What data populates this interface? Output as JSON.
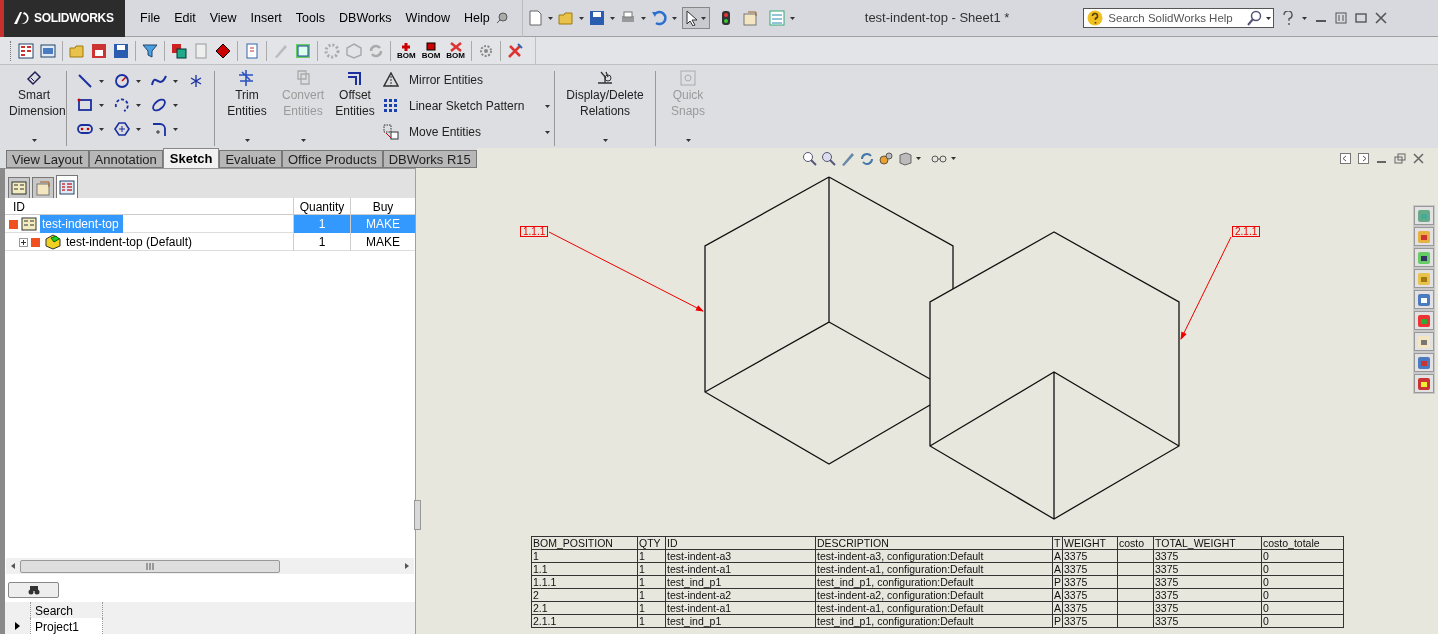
{
  "app": {
    "logo": "SOLIDWORKS"
  },
  "menu": [
    "File",
    "Edit",
    "View",
    "Insert",
    "Tools",
    "DBWorks",
    "Window",
    "Help"
  ],
  "window_title": "test-indent-top - Sheet1 *",
  "help_search": {
    "placeholder": "Search SolidWorks Help"
  },
  "bom_buttons": [
    {
      "kind": "add",
      "caption": "BOM"
    },
    {
      "kind": "copy",
      "caption": "BOM"
    },
    {
      "kind": "delete",
      "caption": "BOM"
    }
  ],
  "commands": [
    {
      "kind": "large",
      "label": "Smart Dimension",
      "disabled": false,
      "dropdown": true
    },
    {
      "kind": "sketch-grid"
    },
    {
      "kind": "large",
      "label": "Trim Entities",
      "disabled": false,
      "dropdown": true
    },
    {
      "kind": "large",
      "label": "Convert Entities",
      "disabled": true,
      "dropdown": true
    },
    {
      "kind": "large",
      "label": "Offset Entities",
      "disabled": false,
      "dropdown": false
    },
    {
      "kind": "list",
      "items": [
        {
          "label": "Mirror Entities",
          "dropdown": false
        },
        {
          "label": "Linear Sketch Pattern",
          "dropdown": true
        },
        {
          "label": "Move Entities",
          "dropdown": true
        }
      ]
    },
    {
      "kind": "large",
      "label": "Display/Delete Relations",
      "disabled": false,
      "dropdown": true
    },
    {
      "kind": "large",
      "label": "Quick Snaps",
      "disabled": true,
      "dropdown": true
    }
  ],
  "tabs": [
    {
      "label": "View Layout",
      "selected": false
    },
    {
      "label": "Annotation",
      "selected": false
    },
    {
      "label": "Sketch",
      "selected": true
    },
    {
      "label": "Evaluate",
      "selected": false
    },
    {
      "label": "Office Products",
      "selected": false
    },
    {
      "label": "DBWorks R15",
      "selected": false
    }
  ],
  "panel_tabs": [
    {
      "selected": false
    },
    {
      "selected": false
    },
    {
      "selected": true
    }
  ],
  "tree": {
    "columns": [
      "ID",
      "Quantity",
      "Buy"
    ],
    "rows": [
      {
        "id": "test-indent-top",
        "quantity": "1",
        "buy": "MAKE",
        "selected": true,
        "expanded": true,
        "children": [
          {
            "id": "test-indent-top (Default)",
            "quantity": "1",
            "buy": "MAKE",
            "selected": false,
            "expanded": false
          }
        ]
      }
    ]
  },
  "search_panel": {
    "items": [
      {
        "label": "Search",
        "current": false
      },
      {
        "label": "Project1",
        "current": true
      }
    ]
  },
  "balloons": [
    {
      "label": "1.1.1"
    },
    {
      "label": "2.1.1"
    }
  ],
  "bom_table": {
    "columns": [
      "BOM_POSITION",
      "QTY",
      "ID",
      "DESCRIPTION",
      "T",
      "WEIGHT",
      "costo",
      "TOTAL_WEIGHT",
      "costo_totale"
    ],
    "rows": [
      [
        "1",
        "1",
        "test-indent-a3",
        "test-indent-a3, configuration:Default",
        "A",
        "3375",
        "",
        "3375",
        "0"
      ],
      [
        "1.1",
        "1",
        "test-indent-a1",
        "test-indent-a1, configuration:Default",
        "A",
        "3375",
        "",
        "3375",
        "0"
      ],
      [
        "1.1.1",
        "1",
        "test_ind_p1",
        "test_ind_p1, configuration:Default",
        "P",
        "3375",
        "",
        "3375",
        "0"
      ],
      [
        "2",
        "1",
        "test-indent-a2",
        "test-indent-a2, configuration:Default",
        "A",
        "3375",
        "",
        "3375",
        "0"
      ],
      [
        "2.1",
        "1",
        "test-indent-a1",
        "test-indent-a1, configuration:Default",
        "A",
        "3375",
        "",
        "3375",
        "0"
      ],
      [
        "2.1.1",
        "1",
        "test_ind_p1",
        "test_ind_p1, configuration:Default",
        "P",
        "3375",
        "",
        "3375",
        "0"
      ]
    ]
  }
}
